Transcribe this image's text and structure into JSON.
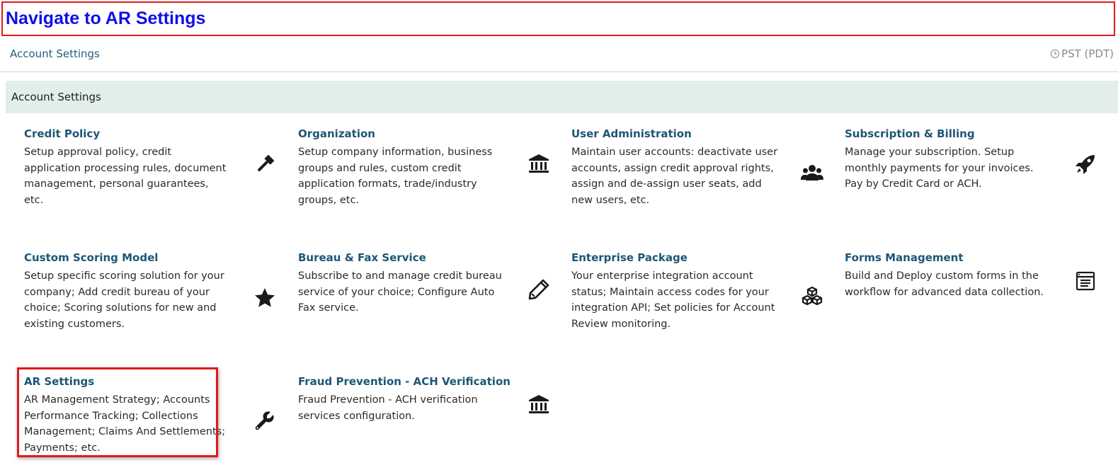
{
  "annotation": {
    "text": "Navigate to AR Settings"
  },
  "topbar": {
    "breadcrumb": "Account Settings",
    "timezone": "PST (PDT)"
  },
  "panel": {
    "title": "Account Settings",
    "cards": [
      {
        "title": "Credit Policy",
        "description": "Setup approval policy, credit application processing rules, document management, personal guarantees, etc.",
        "icon": "gavel-icon"
      },
      {
        "title": "Organization",
        "description": "Setup company information, business groups and rules, custom credit application formats, trade/industry groups, etc.",
        "icon": "bank-icon"
      },
      {
        "title": "User Administration",
        "description": "Maintain user accounts: deactivate user accounts, assign credit approval rights, assign and de-assign user seats, add new users, etc.",
        "icon": "users-icon"
      },
      {
        "title": "Subscription & Billing",
        "description": "Manage your subscription. Setup monthly payments for your invoices. Pay by Credit Card or ACH.",
        "icon": "rocket-icon"
      },
      {
        "title": "Custom Scoring Model",
        "description": "Setup specific scoring solution for your company; Add credit bureau of your choice; Scoring solutions for new and existing customers.",
        "icon": "star-icon"
      },
      {
        "title": "Bureau & Fax Service",
        "description": "Subscribe to and manage credit bureau service of your choice; Configure Auto Fax service.",
        "icon": "pencil-icon"
      },
      {
        "title": "Enterprise Package",
        "description": "Your enterprise integration account status; Maintain access codes for your integration API; Set policies for Account Review monitoring.",
        "icon": "cubes-icon"
      },
      {
        "title": "Forms Management",
        "description": "Build and Deploy custom forms in the workflow for advanced data collection.",
        "icon": "form-icon"
      },
      {
        "title": "AR Settings",
        "description": "AR Management Strategy; Accounts Performance Tracking; Collections Management; Claims And Settlements; Payments; etc.",
        "icon": "wrench-icon"
      },
      {
        "title": "Fraud Prevention - ACH Verification",
        "description": "Fraud Prevention - ACH verification services configuration.",
        "icon": "bank-icon"
      }
    ]
  },
  "colors": {
    "annotation_border": "#e0191c",
    "annotation_text": "#1010e8",
    "link": "#1d5676",
    "panel_header_bg": "#e2eeeb"
  }
}
